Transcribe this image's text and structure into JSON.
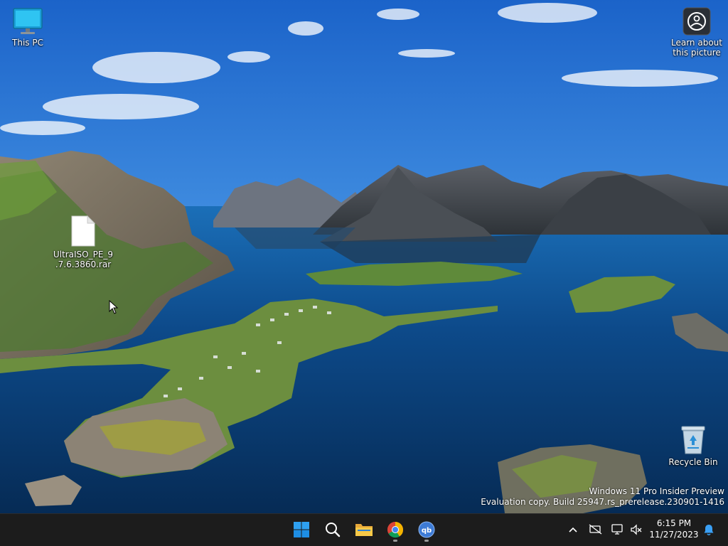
{
  "desktop": {
    "icons": [
      {
        "label": "This PC",
        "icon": "monitor-icon"
      },
      {
        "label": "UltraISO_PE_9.7.6.3860.rar",
        "icon": "file-icon"
      },
      {
        "label": "Recycle Bin",
        "icon": "recycle-bin-icon"
      },
      {
        "label": "Learn about this picture",
        "icon": "camera-spotlight-icon"
      }
    ],
    "watermark": {
      "line1": "Windows 11 Pro Insider Preview",
      "line2": "Evaluation copy. Build 25947.rs_prerelease.230901-1416"
    }
  },
  "taskbar": {
    "apps": [
      {
        "name": "Start",
        "icon": "windows-start-icon"
      },
      {
        "name": "Search",
        "icon": "search-icon"
      },
      {
        "name": "File Explorer",
        "icon": "folder-icon"
      },
      {
        "name": "Google Chrome",
        "icon": "chrome-icon"
      },
      {
        "name": "qBittorrent",
        "icon": "qbittorrent-icon"
      }
    ],
    "tray": {
      "time": "6:15 PM",
      "date": "11/27/2023"
    }
  },
  "colors": {
    "taskbar_bg": "#1c1c1c",
    "accent": "#0078d4",
    "sky_top": "#1f6fd1",
    "sea": "#0b3a6e"
  }
}
